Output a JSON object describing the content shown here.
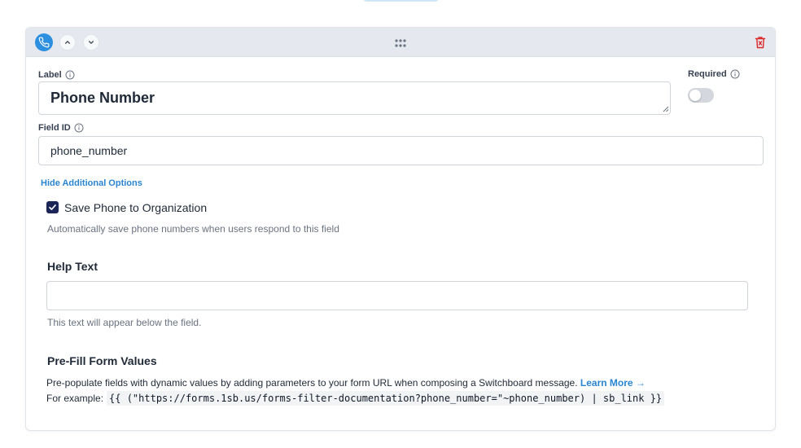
{
  "header": {
    "field_type_icon": "phone-icon",
    "move_up_icon": "chevron-up-icon",
    "move_down_icon": "chevron-down-icon",
    "drag_icon": "drag-grip-icon",
    "delete_icon": "trash-icon",
    "accent_color": "#2d8fdf",
    "delete_color": "#dc2626"
  },
  "label": {
    "title": "Label",
    "value": "Phone Number"
  },
  "required": {
    "title": "Required",
    "enabled": false
  },
  "field_id": {
    "title": "Field ID",
    "value": "phone_number"
  },
  "options_toggle": "Hide Additional Options",
  "save_phone": {
    "label": "Save Phone to Organization",
    "checked": true,
    "hint": "Automatically save phone numbers when users respond to this field"
  },
  "help_text": {
    "title": "Help Text",
    "value": "",
    "hint": "This text will appear below the field."
  },
  "prefill": {
    "title": "Pre-Fill Form Values",
    "description": "Pre-populate fields with dynamic values by adding parameters to your form URL when composing a Switchboard message.",
    "learn_more": "Learn More →",
    "example_label": "For example:",
    "example_code": "{{ (\"https://forms.1sb.us/forms-filter-documentation?phone_number=\"~phone_number) | sb_link }}"
  }
}
